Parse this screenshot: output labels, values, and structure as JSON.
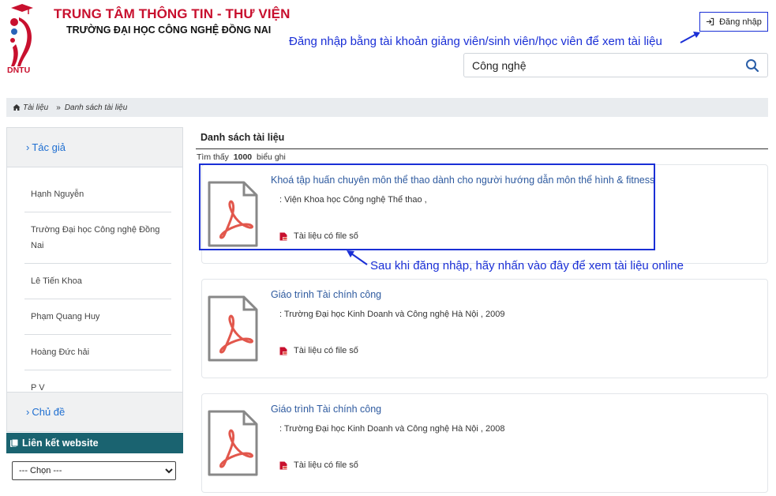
{
  "header": {
    "logo_text": "DNTU",
    "title": "TRUNG TÂM THÔNG TIN - THƯ VIỆN",
    "subtitle": "TRƯỜNG ĐẠI HỌC CÔNG NGHỆ ĐỒNG NAI",
    "login_label": "Đăng nhập",
    "login_note": "Đăng nhập bằng tài khoản giảng viên/sinh viên/học viên để xem tài liệu",
    "search_value": "Công nghệ"
  },
  "breadcrumb": {
    "items": [
      "Tài liệu",
      "Danh sách tài liệu"
    ]
  },
  "sidebar": {
    "author_heading": "Tác giả",
    "authors": [
      "Hạnh Nguyễn",
      "Trường Đại học Công nghệ Đồng Nai",
      "Lê Tiến Khoa",
      "Phạm Quang Huy",
      "Hoàng Đức hải",
      "P V"
    ],
    "subject_heading": "Chủ đề",
    "links_heading": "Liên kết website",
    "links_select": "--- Chọn ---"
  },
  "main": {
    "list_title": "Danh sách tài liệu",
    "found_prefix": "Tìm thấy",
    "found_count": "1000",
    "found_suffix": "biểu ghi",
    "click_note": "Sau khi đăng nhập, hãy nhấn vào đây để xem tài liệu online",
    "documents": [
      {
        "title": "Khoá tập huấn chuyên môn thể thao dành cho người hướng dẫn môn thể hình & fitness",
        "author": ": Viện Khoa học Công nghệ Thể thao ,",
        "file_label": "Tài liệu có file số"
      },
      {
        "title": "Giáo trình Tài chính công",
        "author": ": Trường Đại học Kinh Doanh và Công nghệ Hà Nội , 2009",
        "file_label": "Tài liệu có file số"
      },
      {
        "title": "Giáo trình Tài chính công",
        "author": ": Trường Đại học Kinh Doanh và Công nghệ Hà Nội , 2008",
        "file_label": "Tài liệu có file số"
      }
    ]
  },
  "colors": {
    "brand_red": "#c8102e",
    "annotation_blue": "#1a2fd6",
    "link_blue": "#2e5a9f",
    "sidebar_link_blue": "#1f6fd1",
    "links_bar_teal": "#1a6370"
  },
  "icons": [
    "login-icon",
    "search-icon",
    "home-icon",
    "pdf-file-icon",
    "pdf-small-icon",
    "link-icon"
  ]
}
